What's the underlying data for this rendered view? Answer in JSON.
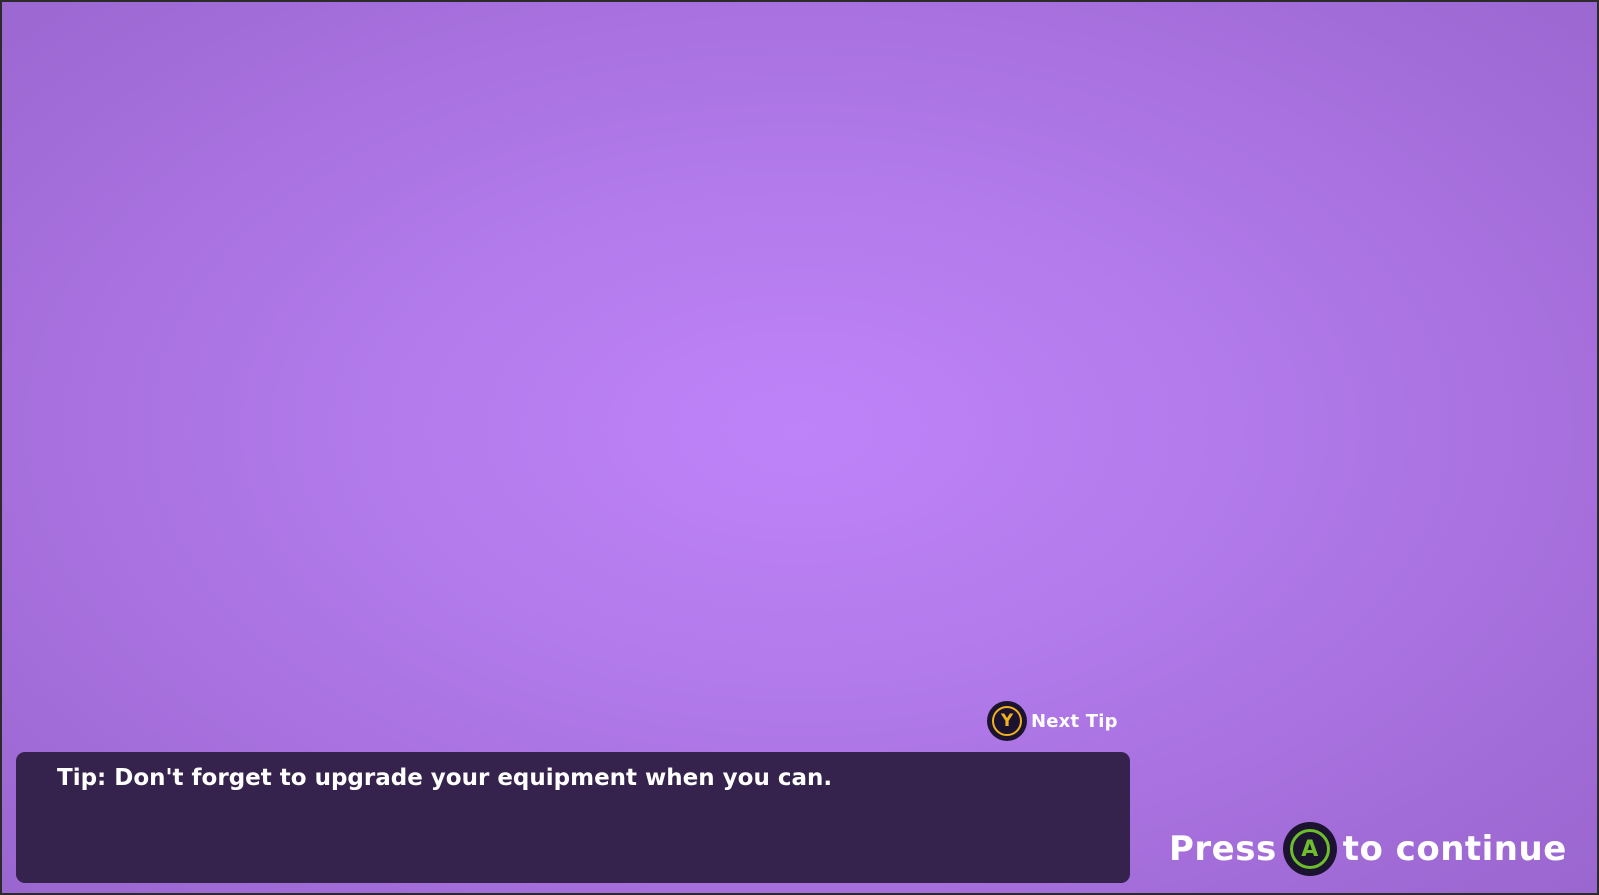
{
  "next_tip": {
    "button_glyph": "Y",
    "button_color": "#f2b21f",
    "label": "Next Tip",
    "icon": "y-button-icon"
  },
  "tip": {
    "text": "Tip: Don't forget to upgrade your equipment when you can."
  },
  "continue_prompt": {
    "before": "Press",
    "button_glyph": "A",
    "button_color": "#6dbd2c",
    "after": "to continue",
    "icon": "a-button-icon"
  },
  "colors": {
    "background_center": "#bf83f9",
    "background_edge": "#9a66cf",
    "panel": "#35224d"
  }
}
